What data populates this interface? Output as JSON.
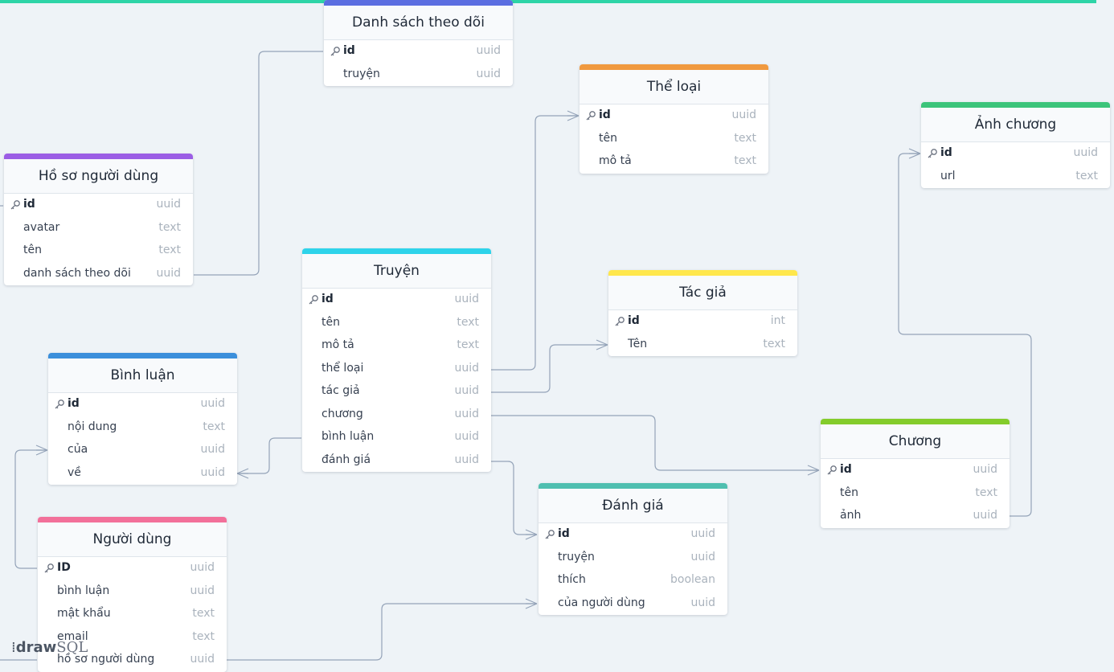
{
  "brand": {
    "logo_bold": "draw",
    "logo_rest": "SQL"
  },
  "tables": {
    "danh_sach": {
      "title": "Danh sách theo dõi",
      "accent": "#5b6ee1",
      "fields": [
        {
          "name": "id",
          "type": "uuid"
        },
        {
          "name": "truyện",
          "type": "uuid"
        }
      ]
    },
    "the_loai": {
      "title": "Thể loại",
      "accent": "#f0993f",
      "fields": [
        {
          "name": "id",
          "type": "uuid"
        },
        {
          "name": "tên",
          "type": "text"
        },
        {
          "name": "mô tả",
          "type": "text"
        }
      ]
    },
    "anh_chuong": {
      "title": "Ảnh chương",
      "accent": "#3cc47a",
      "fields": [
        {
          "name": "id",
          "type": "uuid"
        },
        {
          "name": "url",
          "type": "text"
        }
      ]
    },
    "ho_so": {
      "title": "Hồ sơ người dùng",
      "accent": "#9b5de5",
      "fields": [
        {
          "name": "id",
          "type": "uuid"
        },
        {
          "name": "avatar",
          "type": "text"
        },
        {
          "name": "tên",
          "type": "text"
        },
        {
          "name": "danh sách theo dõi",
          "type": "uuid"
        }
      ]
    },
    "truyen": {
      "title": "Truyện",
      "accent": "#2ed3ea",
      "fields": [
        {
          "name": "id",
          "type": "uuid"
        },
        {
          "name": "tên",
          "type": "text"
        },
        {
          "name": "mô tả",
          "type": "text"
        },
        {
          "name": "thể loại",
          "type": "uuid"
        },
        {
          "name": "tác giả",
          "type": "uuid"
        },
        {
          "name": "chương",
          "type": "uuid"
        },
        {
          "name": "bình luận",
          "type": "uuid"
        },
        {
          "name": "đánh giá",
          "type": "uuid"
        }
      ]
    },
    "tac_gia": {
      "title": "Tác giả",
      "accent": "#ffe74c",
      "fields": [
        {
          "name": "id",
          "type": "int"
        },
        {
          "name": "Tên",
          "type": "text"
        }
      ]
    },
    "binh_luan": {
      "title": "Bình luận",
      "accent": "#3b8fdb",
      "fields": [
        {
          "name": "id",
          "type": "uuid"
        },
        {
          "name": "nội dung",
          "type": "text"
        },
        {
          "name": "của",
          "type": "uuid"
        },
        {
          "name": "về",
          "type": "uuid"
        }
      ]
    },
    "chuong": {
      "title": "Chương",
      "accent": "#84cc2b",
      "fields": [
        {
          "name": "id",
          "type": "uuid"
        },
        {
          "name": "tên",
          "type": "text"
        },
        {
          "name": "ảnh",
          "type": "uuid"
        }
      ]
    },
    "danh_gia": {
      "title": "Đánh giá",
      "accent": "#4fbfb0",
      "fields": [
        {
          "name": "id",
          "type": "uuid"
        },
        {
          "name": "truyện",
          "type": "uuid"
        },
        {
          "name": "thích",
          "type": "boolean"
        },
        {
          "name": "của người dùng",
          "type": "uuid"
        }
      ]
    },
    "nguoi_dung": {
      "title": "Người dùng",
      "accent": "#f2709a",
      "fields": [
        {
          "name": "ID",
          "type": "uuid"
        },
        {
          "name": "bình luận",
          "type": "uuid"
        },
        {
          "name": "mật khẩu",
          "type": "text"
        },
        {
          "name": "email",
          "type": "text"
        },
        {
          "name": "hồ sơ người dùng",
          "type": "uuid"
        }
      ]
    }
  }
}
